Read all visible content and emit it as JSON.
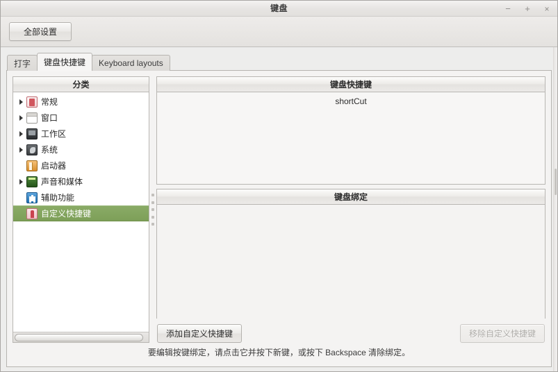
{
  "window": {
    "title": "键盘",
    "controls": {
      "minimize": "−",
      "maximize": "+",
      "close": "×"
    }
  },
  "toolbar": {
    "all_settings_label": "全部设置"
  },
  "tabs": [
    {
      "label": "打字",
      "active": false
    },
    {
      "label": "键盘快捷键",
      "active": true
    },
    {
      "label": "Keyboard layouts",
      "active": false
    }
  ],
  "sidebar": {
    "header": "分类",
    "items": [
      {
        "label": "常规",
        "expandable": true,
        "icon": "general-icon",
        "selected": false
      },
      {
        "label": "窗口",
        "expandable": true,
        "icon": "window-icon",
        "selected": false
      },
      {
        "label": "工作区",
        "expandable": true,
        "icon": "workspace-icon",
        "selected": false
      },
      {
        "label": "系统",
        "expandable": true,
        "icon": "system-icon",
        "selected": false
      },
      {
        "label": "启动器",
        "expandable": false,
        "icon": "launcher-icon",
        "selected": false
      },
      {
        "label": "声音和媒体",
        "expandable": true,
        "icon": "sound-icon",
        "selected": false
      },
      {
        "label": "辅助功能",
        "expandable": false,
        "icon": "a11y-icon",
        "selected": false
      },
      {
        "label": "自定义快捷键",
        "expandable": false,
        "icon": "custom-icon",
        "selected": true
      }
    ]
  },
  "shortcuts_panel": {
    "header": "键盘快捷键",
    "rows": [
      {
        "name": "shortCut"
      }
    ]
  },
  "bindings_panel": {
    "header": "键盘绑定",
    "rows": []
  },
  "actions": {
    "add_label": "添加自定义快捷键",
    "remove_label": "移除自定义快捷键",
    "remove_enabled": false
  },
  "status": {
    "hint": "要编辑按键绑定，请点击它并按下新键，或按下 Backspace 清除绑定。"
  },
  "colors": {
    "selection": "#819f59",
    "window_bg": "#ededec",
    "panel_bg": "#f4f3f2",
    "list_bg": "#ffffff",
    "border": "#b8b6b2"
  }
}
